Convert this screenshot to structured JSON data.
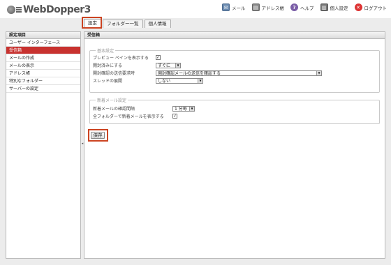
{
  "app": {
    "logo_text": "WebDopper3"
  },
  "top_nav": {
    "mail": "メール",
    "address_book": "アドレス帳",
    "help": "ヘルプ",
    "personal_settings": "個人設定",
    "logout": "ログアウト"
  },
  "tabs": [
    {
      "label": "設定",
      "active": true
    },
    {
      "label": "フォルダー一覧",
      "active": false
    },
    {
      "label": "個人情報",
      "active": false
    }
  ],
  "sidebar": {
    "header": "設定項目",
    "items": [
      {
        "label": "ユーザー インターフェース"
      },
      {
        "label": "受信箱",
        "active": true
      },
      {
        "label": "メールの作成"
      },
      {
        "label": "メールの表示"
      },
      {
        "label": "アドレス帳"
      },
      {
        "label": "特別なフォルダー"
      },
      {
        "label": "サーバーの設定"
      }
    ]
  },
  "main": {
    "header": "受信箱",
    "basic": {
      "legend": "基本設定",
      "preview_pane_label": "プレビュー ペインを表示する",
      "preview_pane_checked": true,
      "mark_read_label": "開封済みにする",
      "mark_read_value": "すぐに",
      "read_receipt_label": "開封確認の送信要求時",
      "read_receipt_value": "開封確認メールの送信を確認する",
      "thread_label": "スレッドの展開",
      "thread_value": "しない"
    },
    "new_mail": {
      "legend": "新着メール設定",
      "check_interval_label": "新着メールの確認間隔",
      "check_interval_value": "1 分毎",
      "all_folders_label": "全フォルダーで新着メールを表示する",
      "all_folders_checked": true
    },
    "save_label": "保存"
  },
  "colors": {
    "accent": "#c8322f",
    "highlight": "#cc4422"
  }
}
